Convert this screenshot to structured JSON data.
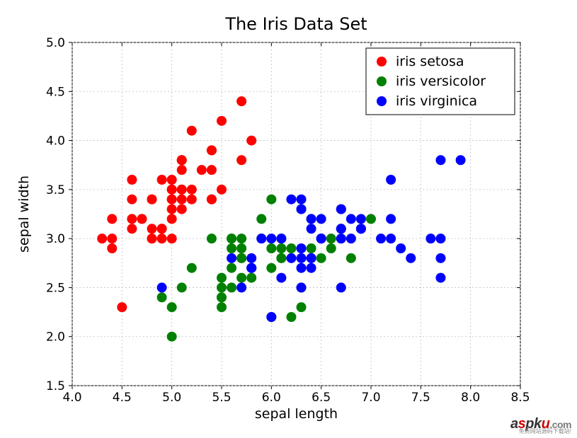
{
  "chart_data": {
    "type": "scatter",
    "title": "The Iris Data Set",
    "xlabel": "sepal length",
    "ylabel": "sepal width",
    "xlim": [
      4.0,
      8.5
    ],
    "ylim": [
      1.5,
      5.0
    ],
    "xticks": [
      4.0,
      4.5,
      5.0,
      5.5,
      6.0,
      6.5,
      7.0,
      7.5,
      8.0,
      8.5
    ],
    "yticks": [
      1.5,
      2.0,
      2.5,
      3.0,
      3.5,
      4.0,
      4.5,
      5.0
    ],
    "legend": {
      "position": "upper-right",
      "entries": [
        "iris setosa",
        "iris versicolor",
        "iris virginica"
      ]
    },
    "series": [
      {
        "name": "iris setosa",
        "color": "#ff0000",
        "points": [
          [
            5.1,
            3.5
          ],
          [
            4.9,
            3.0
          ],
          [
            4.7,
            3.2
          ],
          [
            4.6,
            3.1
          ],
          [
            5.0,
            3.6
          ],
          [
            5.4,
            3.9
          ],
          [
            4.6,
            3.4
          ],
          [
            5.0,
            3.4
          ],
          [
            4.4,
            2.9
          ],
          [
            4.9,
            3.1
          ],
          [
            5.4,
            3.7
          ],
          [
            4.8,
            3.4
          ],
          [
            4.8,
            3.0
          ],
          [
            4.3,
            3.0
          ],
          [
            5.8,
            4.0
          ],
          [
            5.7,
            4.4
          ],
          [
            5.4,
            3.9
          ],
          [
            5.1,
            3.5
          ],
          [
            5.7,
            3.8
          ],
          [
            5.1,
            3.8
          ],
          [
            5.4,
            3.4
          ],
          [
            5.1,
            3.7
          ],
          [
            4.6,
            3.6
          ],
          [
            5.1,
            3.3
          ],
          [
            4.8,
            3.4
          ],
          [
            5.0,
            3.0
          ],
          [
            5.0,
            3.4
          ],
          [
            5.2,
            3.5
          ],
          [
            5.2,
            3.4
          ],
          [
            4.7,
            3.2
          ],
          [
            4.8,
            3.1
          ],
          [
            5.4,
            3.4
          ],
          [
            5.2,
            4.1
          ],
          [
            5.5,
            4.2
          ],
          [
            4.9,
            3.1
          ],
          [
            5.0,
            3.2
          ],
          [
            5.5,
            3.5
          ],
          [
            4.9,
            3.6
          ],
          [
            4.4,
            3.0
          ],
          [
            5.1,
            3.4
          ],
          [
            5.0,
            3.5
          ],
          [
            4.5,
            2.3
          ],
          [
            4.4,
            3.2
          ],
          [
            5.0,
            3.5
          ],
          [
            5.1,
            3.8
          ],
          [
            4.8,
            3.0
          ],
          [
            5.1,
            3.8
          ],
          [
            4.6,
            3.2
          ],
          [
            5.3,
            3.7
          ],
          [
            5.0,
            3.3
          ]
        ]
      },
      {
        "name": "iris versicolor",
        "color": "#008000",
        "points": [
          [
            7.0,
            3.2
          ],
          [
            6.4,
            3.2
          ],
          [
            6.9,
            3.1
          ],
          [
            5.5,
            2.3
          ],
          [
            6.5,
            2.8
          ],
          [
            5.7,
            2.8
          ],
          [
            6.3,
            3.3
          ],
          [
            4.9,
            2.4
          ],
          [
            6.6,
            2.9
          ],
          [
            5.2,
            2.7
          ],
          [
            5.0,
            2.0
          ],
          [
            5.9,
            3.0
          ],
          [
            6.0,
            2.2
          ],
          [
            6.1,
            2.9
          ],
          [
            5.6,
            2.9
          ],
          [
            6.7,
            3.1
          ],
          [
            5.6,
            3.0
          ],
          [
            5.8,
            2.7
          ],
          [
            6.2,
            2.2
          ],
          [
            5.6,
            2.5
          ],
          [
            5.9,
            3.2
          ],
          [
            6.1,
            2.8
          ],
          [
            6.3,
            2.5
          ],
          [
            6.1,
            2.8
          ],
          [
            6.4,
            2.9
          ],
          [
            6.6,
            3.0
          ],
          [
            6.8,
            2.8
          ],
          [
            6.7,
            3.0
          ],
          [
            6.0,
            2.9
          ],
          [
            5.7,
            2.6
          ],
          [
            5.5,
            2.4
          ],
          [
            5.5,
            2.4
          ],
          [
            5.8,
            2.7
          ],
          [
            6.0,
            2.7
          ],
          [
            5.4,
            3.0
          ],
          [
            6.0,
            3.4
          ],
          [
            6.7,
            3.1
          ],
          [
            6.3,
            2.3
          ],
          [
            5.6,
            3.0
          ],
          [
            5.5,
            2.5
          ],
          [
            5.5,
            2.6
          ],
          [
            6.1,
            3.0
          ],
          [
            5.8,
            2.6
          ],
          [
            5.0,
            2.3
          ],
          [
            5.6,
            2.7
          ],
          [
            5.7,
            3.0
          ],
          [
            5.7,
            2.9
          ],
          [
            6.2,
            2.9
          ],
          [
            5.1,
            2.5
          ],
          [
            5.7,
            2.8
          ]
        ]
      },
      {
        "name": "iris virginica",
        "color": "#0000ff",
        "points": [
          [
            6.3,
            3.3
          ],
          [
            5.8,
            2.7
          ],
          [
            7.1,
            3.0
          ],
          [
            6.3,
            2.9
          ],
          [
            6.5,
            3.0
          ],
          [
            7.6,
            3.0
          ],
          [
            4.9,
            2.5
          ],
          [
            7.3,
            2.9
          ],
          [
            6.7,
            2.5
          ],
          [
            7.2,
            3.6
          ],
          [
            6.5,
            3.2
          ],
          [
            6.4,
            2.7
          ],
          [
            6.8,
            3.0
          ],
          [
            5.7,
            2.5
          ],
          [
            5.8,
            2.8
          ],
          [
            6.4,
            3.2
          ],
          [
            6.5,
            3.0
          ],
          [
            7.7,
            3.8
          ],
          [
            7.7,
            2.6
          ],
          [
            6.0,
            2.2
          ],
          [
            6.9,
            3.2
          ],
          [
            5.6,
            2.8
          ],
          [
            7.7,
            2.8
          ],
          [
            6.3,
            2.7
          ],
          [
            6.7,
            3.3
          ],
          [
            7.2,
            3.2
          ],
          [
            6.2,
            2.8
          ],
          [
            6.1,
            3.0
          ],
          [
            6.4,
            2.8
          ],
          [
            7.2,
            3.0
          ],
          [
            7.4,
            2.8
          ],
          [
            7.9,
            3.8
          ],
          [
            6.4,
            2.8
          ],
          [
            6.3,
            2.8
          ],
          [
            6.1,
            2.6
          ],
          [
            7.7,
            3.0
          ],
          [
            6.3,
            3.4
          ],
          [
            6.4,
            3.1
          ],
          [
            6.0,
            3.0
          ],
          [
            6.9,
            3.1
          ],
          [
            6.7,
            3.1
          ],
          [
            6.9,
            3.1
          ],
          [
            5.8,
            2.7
          ],
          [
            6.8,
            3.2
          ],
          [
            6.7,
            3.3
          ],
          [
            6.7,
            3.0
          ],
          [
            6.3,
            2.5
          ],
          [
            6.5,
            3.0
          ],
          [
            6.2,
            3.4
          ],
          [
            5.9,
            3.0
          ]
        ]
      }
    ]
  },
  "watermark": {
    "text_parts": [
      "a",
      "s",
      "p",
      "k",
      "u",
      ".",
      "com"
    ],
    "subtext": "免费网站源码下载站!"
  }
}
